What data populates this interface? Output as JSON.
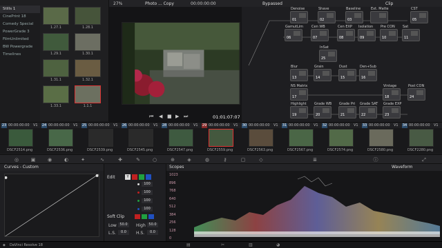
{
  "gallery": {
    "albums": [
      "Stills 1",
      "CinePrint 18",
      "Comedy Special",
      "PowerGrade 3",
      "FilmUnlimited",
      "BW Powergrade",
      "Timelines"
    ],
    "stills": [
      {
        "label": "1.27.1",
        "color": "#5a6a48"
      },
      {
        "label": "1.28.1",
        "color": "#46543a"
      },
      {
        "label": "1.29.1",
        "color": "#405a3c"
      },
      {
        "label": "1.30.1",
        "color": "#6c6e62"
      },
      {
        "label": "1.31.1",
        "color": "#4e6240"
      },
      {
        "label": "1.32.1",
        "color": "#6a5c42"
      },
      {
        "label": "1.33.1",
        "color": "#5a6e46"
      },
      {
        "label": "1.1.1",
        "color": "#6c7060"
      }
    ]
  },
  "viewer": {
    "zoom": "27%",
    "title": "Photo ... Copy",
    "timecode_top": "00:00:00:00",
    "timecode": "01:01:07:07"
  },
  "nodes": {
    "mode": "Bypassed",
    "panel": "Clip",
    "items": [
      {
        "label": "Denoise",
        "num": "01"
      },
      {
        "label": "Shave",
        "num": "02"
      },
      {
        "label": "Baseline",
        "num": "03"
      },
      {
        "label": "Ext. Matte",
        "num": ""
      },
      {
        "label": "CST",
        "num": "05"
      },
      {
        "label": "GamutLim",
        "num": "06"
      },
      {
        "label": "Cen WB",
        "num": "07"
      },
      {
        "label": "Cen EXP",
        "num": "08"
      },
      {
        "label": "Isolation",
        "num": "09"
      },
      {
        "label": "Pre CON",
        "num": "10"
      },
      {
        "label": "Sat",
        "num": "11"
      },
      {
        "label": "Blur",
        "num": "13"
      },
      {
        "label": "Grain",
        "num": "14"
      },
      {
        "label": "Dust",
        "num": "15"
      },
      {
        "label": "Den+Sub",
        "num": "16"
      },
      {
        "label": "NS Matrix",
        "num": "17"
      },
      {
        "label": "Vintage",
        "num": "18"
      },
      {
        "label": "Highlight",
        "num": "19"
      },
      {
        "label": "Grade WB",
        "num": "20"
      },
      {
        "label": "Grade Pri",
        "num": "21"
      },
      {
        "label": "Grade SAT",
        "num": "22"
      },
      {
        "label": "Grade EXP",
        "num": "23"
      },
      {
        "label": "Post CON",
        "num": "24"
      },
      {
        "label": "InSat",
        "num": "25"
      },
      {
        "label": "",
        "num": "12"
      }
    ]
  },
  "clips": [
    {
      "idx": "23",
      "tc": "00:00:00:00",
      "track": "V1",
      "name": "DSCF2514.png",
      "color": "#3a5a3c"
    },
    {
      "idx": "24",
      "tc": "00:00:00:00",
      "track": "V1",
      "name": "DSCF2536.png",
      "color": "#486848"
    },
    {
      "idx": "25",
      "tc": "00:00:00:00",
      "track": "V1",
      "name": "DSCF2539.png",
      "color": "#2a2a2a"
    },
    {
      "idx": "26",
      "tc": "00:00:00:00",
      "track": "V1",
      "name": "DSCF2545.png",
      "color": "#2a2a2a"
    },
    {
      "idx": "28",
      "tc": "00:00:00:00",
      "track": "V1",
      "name": "DSCF2547.png",
      "color": "#3e5a40"
    },
    {
      "idx": "29",
      "tc": "00:00:00:00",
      "track": "V1",
      "name": "DSCF2559.png",
      "color": "#44583e"
    },
    {
      "idx": "30",
      "tc": "00:00:00:00",
      "track": "V1",
      "name": "DSCF2563.png",
      "color": "#5a4c3c"
    },
    {
      "idx": "31",
      "tc": "00:00:00:00",
      "track": "V1",
      "name": "DSCF2567.png",
      "color": "#4a6646"
    },
    {
      "idx": "32",
      "tc": "00:00:00:00",
      "track": "V1",
      "name": "DSCF2574.png",
      "color": "#526a48"
    },
    {
      "idx": "33",
      "tc": "00:00:00:00",
      "track": "V1",
      "name": "DSCF2580.png",
      "color": "#6a6a5c"
    },
    {
      "idx": "34",
      "tc": "00:00:00:00",
      "track": "V1",
      "name": "DSCF2280.png",
      "color": "#485a44"
    }
  ],
  "curves": {
    "title": "Curves - Custom"
  },
  "edit": {
    "label": "Edit",
    "channel_y": "Y",
    "values": [
      "100",
      "100",
      "100",
      "100"
    ],
    "softclip": "Soft Clip",
    "low_label": "Low",
    "low": "50.0",
    "high_label": "High",
    "high": "50.0",
    "ls_label": "L.S.",
    "ls": "0.0",
    "hs_label": "H.S.",
    "hs": "0.0"
  },
  "scopes": {
    "title": "Scopes",
    "mode": "Waveform",
    "ticks": [
      "1023",
      "896",
      "768",
      "640",
      "512",
      "384",
      "256",
      "128",
      "0"
    ]
  },
  "app": {
    "name": "DaVinci Resolve 18"
  }
}
